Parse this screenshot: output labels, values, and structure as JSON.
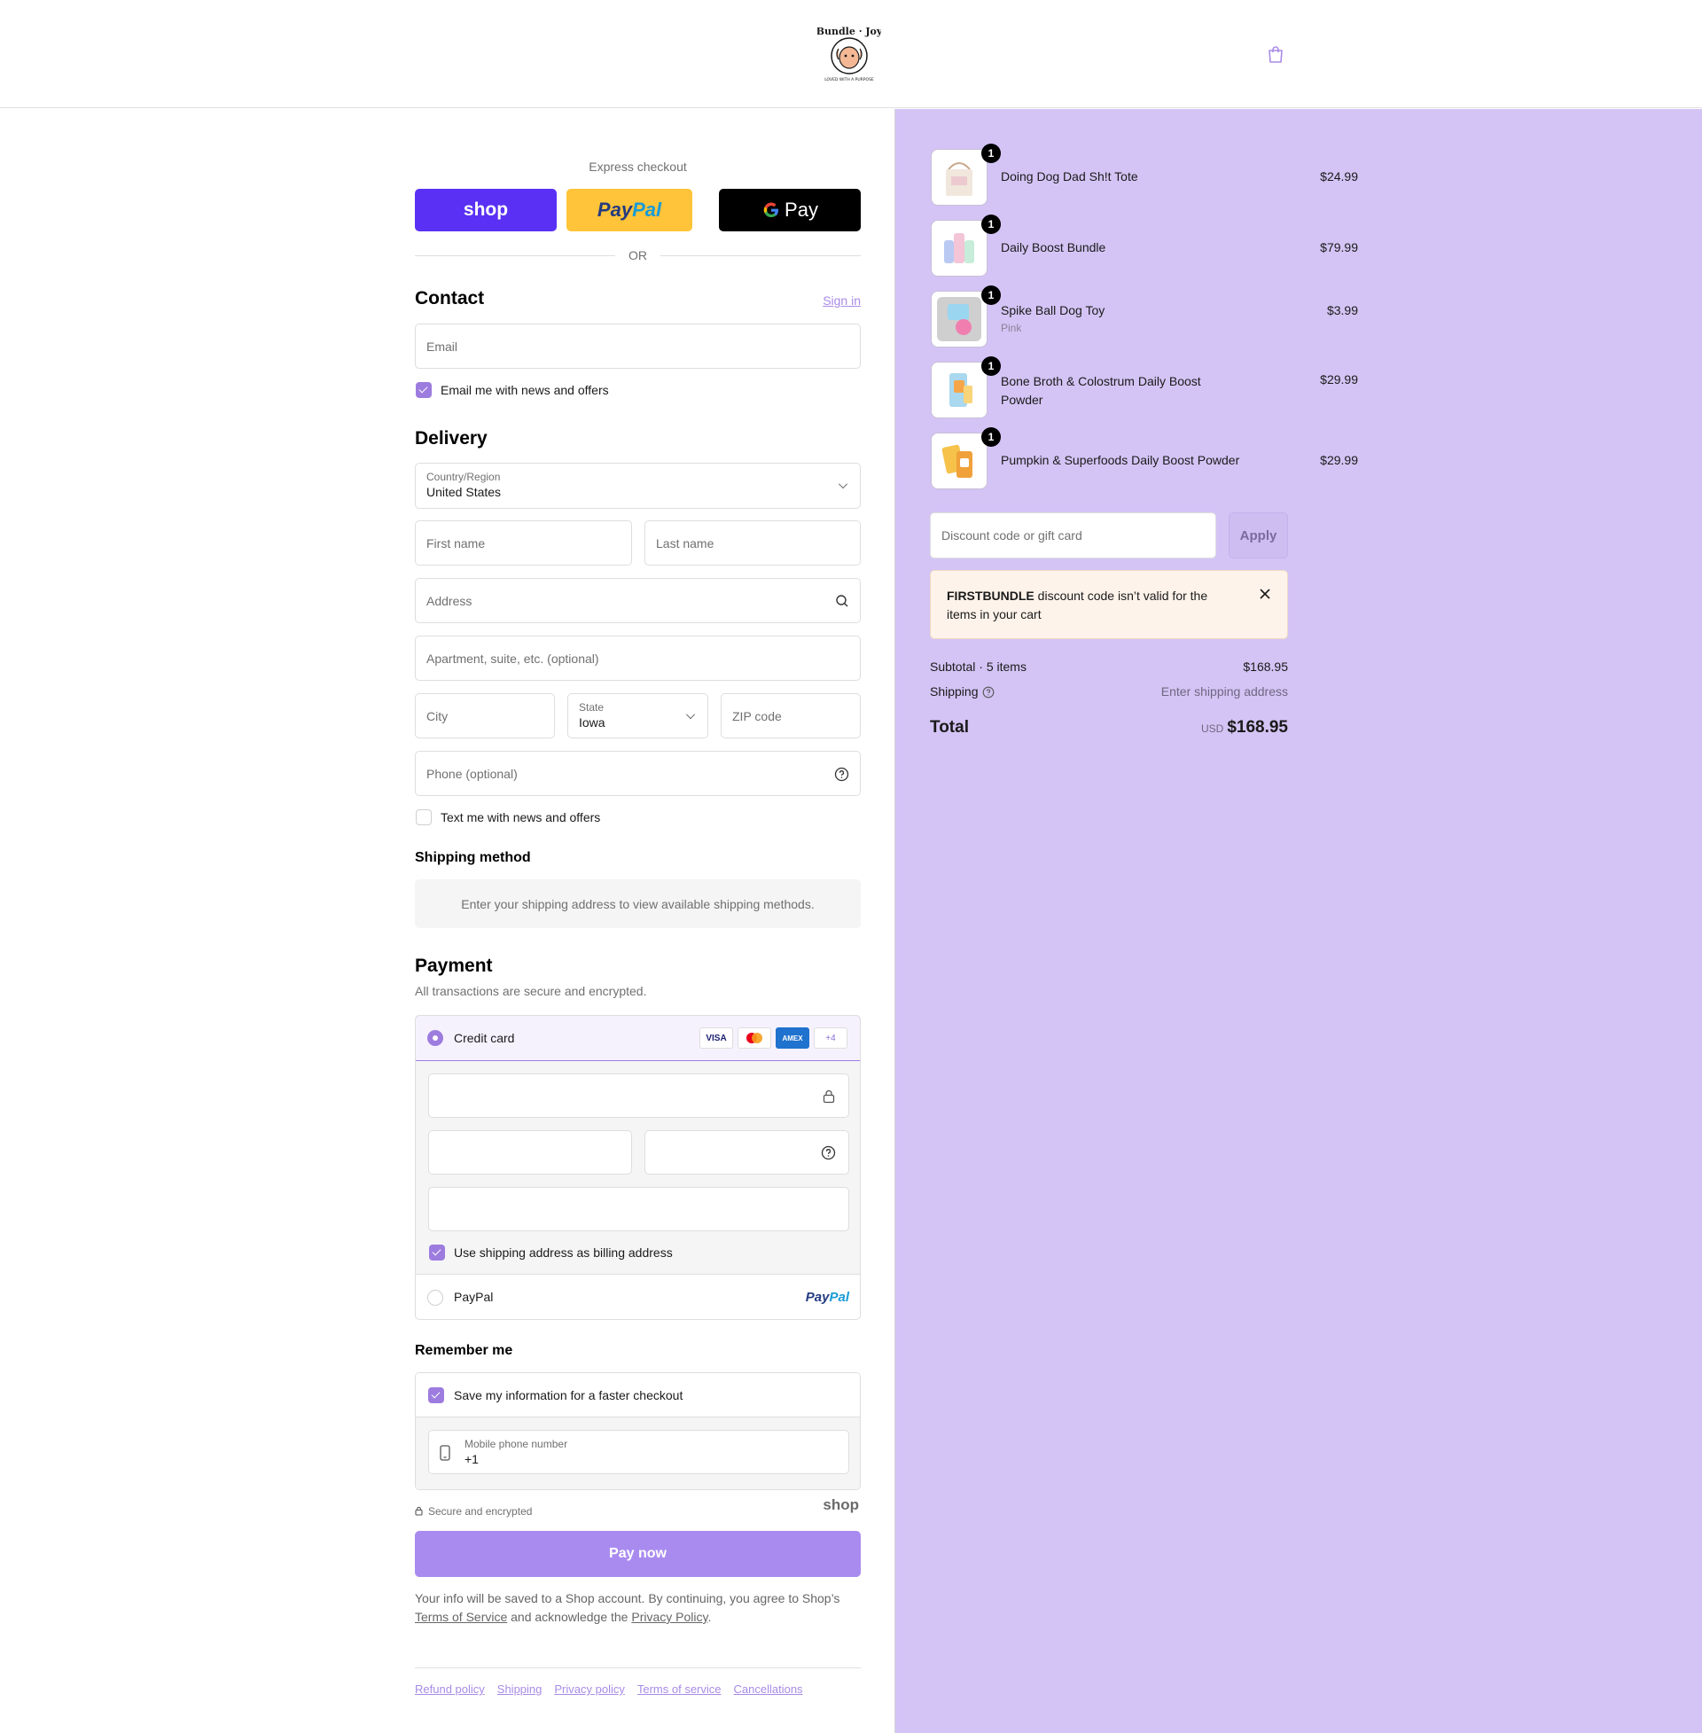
{
  "header": {
    "brand": "Bundle of Joy",
    "brand_tagline": "LOVED WITH A PURPOSE",
    "cart_icon": "shopping-bag-icon"
  },
  "express": {
    "title": "Express checkout",
    "shop_label": "shop",
    "paypal_label_1": "Pay",
    "paypal_label_2": "Pal",
    "gpay_label": "Pay",
    "or_label": "OR"
  },
  "contact": {
    "heading": "Contact",
    "sign_in": "Sign in",
    "email_placeholder": "Email",
    "news_label": "Email me with news and offers"
  },
  "delivery": {
    "heading": "Delivery",
    "country_label": "Country/Region",
    "country_value": "United States",
    "first_name": "First name",
    "last_name": "Last name",
    "address": "Address",
    "apartment": "Apartment, suite, etc. (optional)",
    "city": "City",
    "state_label": "State",
    "state_value": "Iowa",
    "zip": "ZIP code",
    "phone": "Phone (optional)",
    "text_label": "Text me with news and offers"
  },
  "shipping_method": {
    "heading": "Shipping method",
    "notice": "Enter your shipping address to view available shipping methods."
  },
  "payment": {
    "heading": "Payment",
    "subtitle": "All transactions are secure and encrypted.",
    "credit_card_label": "Credit card",
    "cards": [
      "VISA",
      "",
      "AMEX",
      "+4"
    ],
    "billing_label": "Use shipping address as billing address",
    "paypal_label": "PayPal",
    "paypal_logo_1": "Pay",
    "paypal_logo_2": "Pal"
  },
  "remember": {
    "heading": "Remember me",
    "save_label": "Save my information for a faster checkout",
    "mobile_label": "Mobile phone number",
    "mobile_value": "+1",
    "secure_label": "Secure and encrypted",
    "shop_logo": "shop"
  },
  "pay_now": "Pay now",
  "legal": {
    "text_1": "Your info will be saved to a Shop account. By continuing, you agree to Shop’s",
    "tos": "Terms of Service",
    "text_2": "and acknowledge the",
    "privacy": "Privacy Policy",
    "text_3": "."
  },
  "footer_links": [
    "Refund policy",
    "Shipping",
    "Privacy policy",
    "Terms of service",
    "Cancellations"
  ],
  "order": {
    "items": [
      {
        "name": "Doing Dog Dad Sh!t Tote",
        "variant": "",
        "price": "$24.99",
        "qty": "1"
      },
      {
        "name": "Daily Boost Bundle",
        "variant": "",
        "price": "$79.99",
        "qty": "1"
      },
      {
        "name": "Spike Ball Dog Toy",
        "variant": "Pink",
        "price": "$3.99",
        "qty": "1"
      },
      {
        "name": "Bone Broth & Colostrum Daily Boost Powder",
        "variant": "",
        "price": "$29.99",
        "qty": "1"
      },
      {
        "name": "Pumpkin & Superfoods Daily Boost Powder",
        "variant": "",
        "price": "$29.99",
        "qty": "1"
      }
    ],
    "discount_placeholder": "Discount code or gift card",
    "apply_label": "Apply",
    "error_code": "FIRSTBUNDLE",
    "error_text": "discount code isn’t valid for the items in your cart",
    "subtotal_label": "Subtotal · 5 items",
    "subtotal_value": "$168.95",
    "shipping_label": "Shipping",
    "shipping_value": "Enter shipping address",
    "total_label": "Total",
    "currency": "USD",
    "total_value": "$168.95"
  },
  "colors": {
    "accent": "#9d7cdf",
    "sidebar_bg": "#d4c4f5",
    "shop_purple": "#5a31f4",
    "paypal_yellow": "#ffc439",
    "pay_button": "#a98bf0"
  }
}
